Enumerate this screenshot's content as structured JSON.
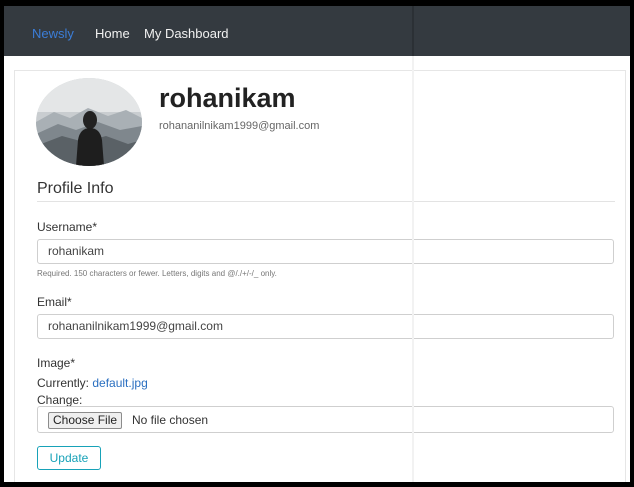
{
  "navbar": {
    "brand": "Newsly",
    "links": [
      {
        "label": "Home"
      },
      {
        "label": "My Dashboard"
      }
    ]
  },
  "profile": {
    "username": "rohanikam",
    "email": "rohananilnikam1999@gmail.com"
  },
  "section": {
    "title": "Profile Info"
  },
  "form": {
    "username_label": "Username*",
    "username_value": "rohanikam",
    "username_help": "Required. 150 characters or fewer. Letters, digits and @/./+/-/_ only.",
    "email_label": "Email*",
    "email_value": "rohananilnikam1999@gmail.com",
    "image_label": "Image*",
    "currently_label": "Currently:",
    "current_file": "default.jpg",
    "change_label": "Change:",
    "choose_file_label": "Choose File",
    "no_file_text": "No file chosen",
    "submit_label": "Update"
  },
  "colors": {
    "navbar_bg": "#343a40",
    "brand": "#3b7dd8",
    "link": "#2a6fc0",
    "update_accent": "#17a2b8"
  }
}
